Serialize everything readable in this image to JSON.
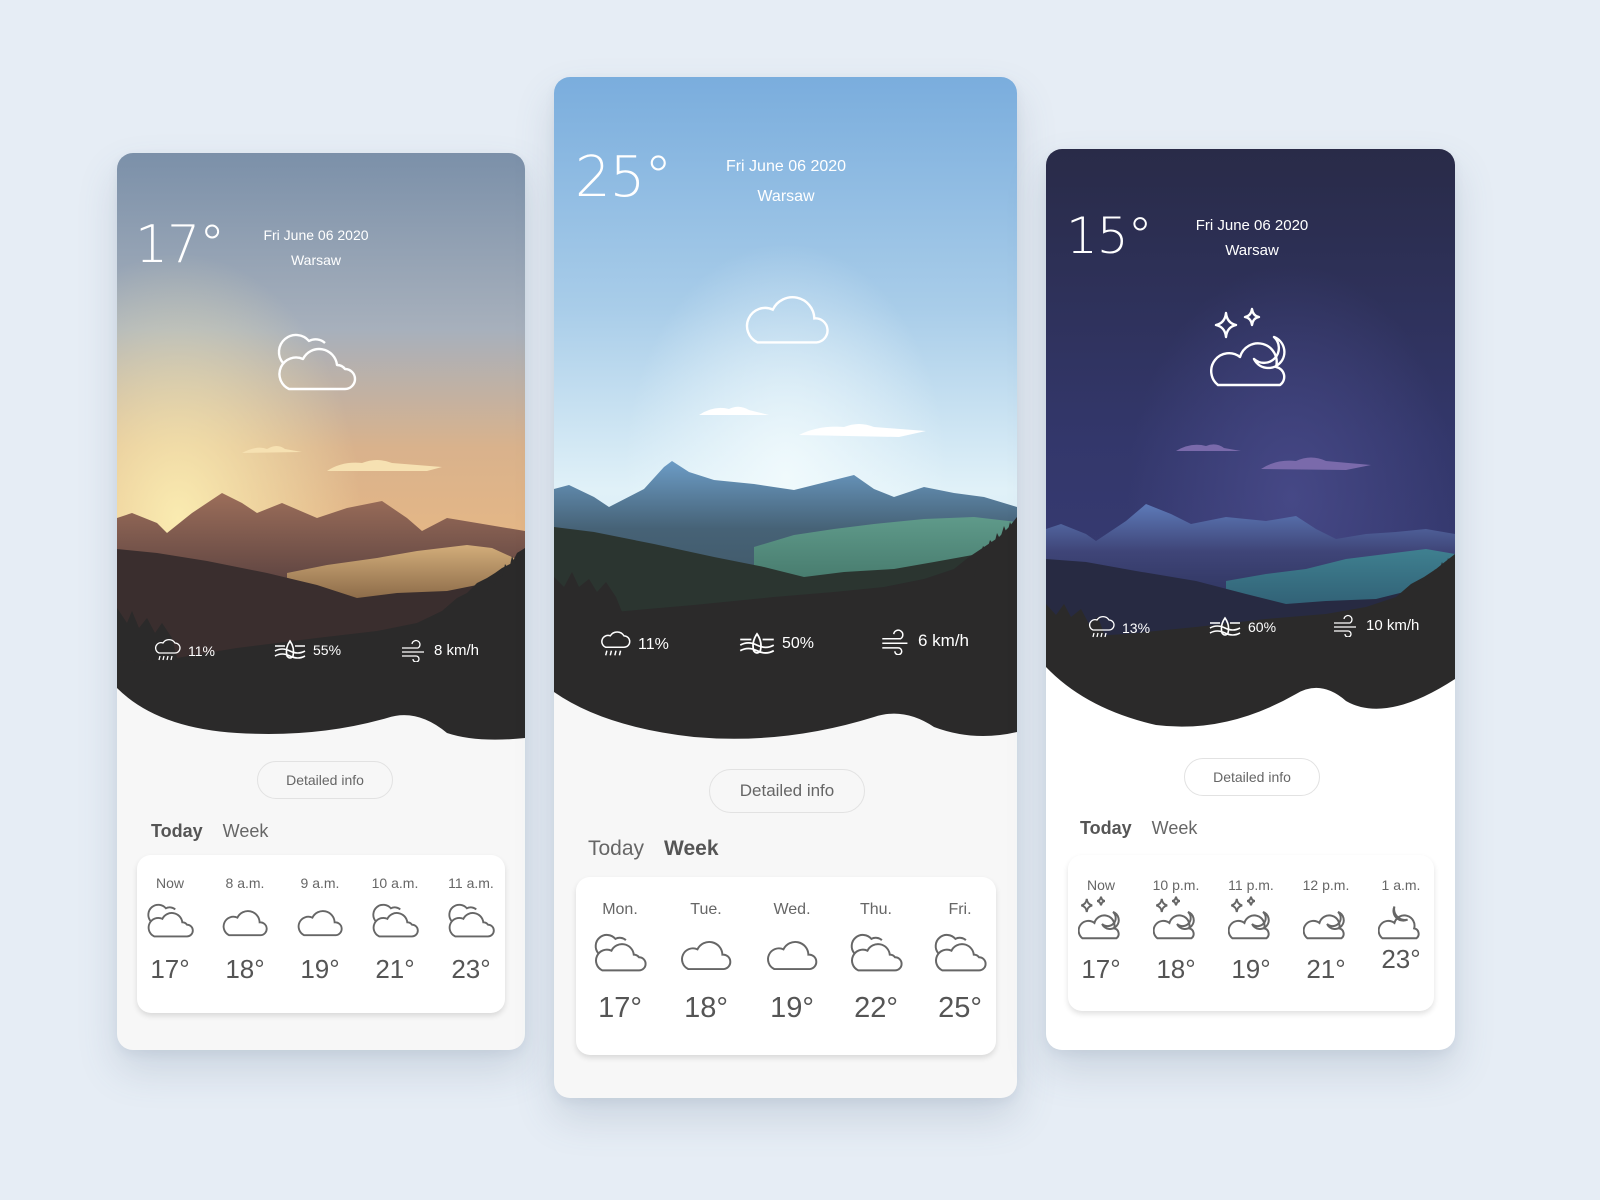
{
  "background_color": "#e6edf5",
  "cards": [
    {
      "id": "sunset",
      "theme": "sunset",
      "temperature": "17°",
      "date": "Fri June 06 2020",
      "city": "Warsaw",
      "main_icon": "partly-cloudy-icon",
      "stats": {
        "precipitation": "11%",
        "humidity": "55%",
        "wind": "8 km/h"
      },
      "detail_button": "Detailed info",
      "tabs": [
        {
          "label": "Today",
          "active": true
        },
        {
          "label": "Week",
          "active": false
        }
      ],
      "forecast": [
        {
          "time": "Now",
          "icon": "partly-cloudy-icon",
          "temp": "17°"
        },
        {
          "time": "8 a.m.",
          "icon": "cloud-icon",
          "temp": "18°"
        },
        {
          "time": "9 a.m.",
          "icon": "cloud-icon",
          "temp": "19°"
        },
        {
          "time": "10 a.m.",
          "icon": "partly-cloudy-icon",
          "temp": "21°"
        },
        {
          "time": "11 a.m.",
          "icon": "partly-cloudy-icon",
          "temp": "23°"
        }
      ],
      "colors": {
        "sky_top": "#7d93ad",
        "sky_mid": "#b7b4ae",
        "sky_glow": "#f6e1a6",
        "mountain_far": "#8a6558",
        "mountain_mid": "#5b4440",
        "ground": "#2b2a2a"
      }
    },
    {
      "id": "day",
      "theme": "day",
      "temperature": "25°",
      "date": "Fri June 06 2020",
      "city": "Warsaw",
      "main_icon": "cloud-icon",
      "stats": {
        "precipitation": "11%",
        "humidity": "50%",
        "wind": "6 km/h"
      },
      "detail_button": "Detailed info",
      "tabs": [
        {
          "label": "Today",
          "active": false
        },
        {
          "label": "Week",
          "active": true
        }
      ],
      "forecast": [
        {
          "time": "Mon.",
          "icon": "partly-cloudy-icon",
          "temp": "17°"
        },
        {
          "time": "Tue.",
          "icon": "cloud-icon",
          "temp": "18°"
        },
        {
          "time": "Wed.",
          "icon": "cloud-icon",
          "temp": "19°"
        },
        {
          "time": "Thu.",
          "icon": "partly-cloudy-icon",
          "temp": "22°"
        },
        {
          "time": "Fri.",
          "icon": "partly-cloudy-icon",
          "temp": "25°"
        }
      ],
      "colors": {
        "sky_top": "#7eaedc",
        "sky_mid": "#bcdbee",
        "sky_glow": "#eaf6fb",
        "mountain_far": "#4f6e8c",
        "mountain_mid": "#3b5a5a",
        "ground": "#2b2a2a"
      }
    },
    {
      "id": "night",
      "theme": "night",
      "temperature": "15°",
      "date": "Fri June 06 2020",
      "city": "Warsaw",
      "main_icon": "cloudy-night-stars-icon",
      "stats": {
        "precipitation": "13%",
        "humidity": "60%",
        "wind": "10 km/h"
      },
      "detail_button": "Detailed info",
      "tabs": [
        {
          "label": "Today",
          "active": true
        },
        {
          "label": "Week",
          "active": false
        }
      ],
      "forecast": [
        {
          "time": "Now",
          "icon": "cloudy-night-stars-icon",
          "temp": "17°"
        },
        {
          "time": "10 p.m.",
          "icon": "cloudy-night-stars-icon",
          "temp": "18°"
        },
        {
          "time": "11 p.m.",
          "icon": "cloudy-night-stars-icon",
          "temp": "19°"
        },
        {
          "time": "12 p.m.",
          "icon": "cloudy-night-icon",
          "temp": "21°"
        },
        {
          "time": "1 a.m.",
          "icon": "moon-cloud-icon",
          "temp": "23°"
        }
      ],
      "colors": {
        "sky_top": "#2b2e4f",
        "sky_mid": "#353a6e",
        "sky_glow": "#3f4380",
        "mountain_far": "#4b5890",
        "mountain_mid": "#2f3456",
        "ground": "#2b2a2a"
      }
    }
  ]
}
